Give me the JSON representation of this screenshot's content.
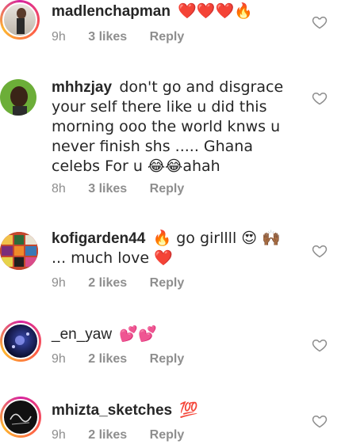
{
  "comments": [
    {
      "username": "madlenchapman",
      "body": "",
      "emojis": "❤️❤️❤️🔥",
      "time": "9h",
      "likes": "3 likes",
      "reply": "Reply"
    },
    {
      "username": "mhhzjay",
      "body": "don't go and disgrace your self there like u did this morning ooo  the world knws u never finish shs ..... Ghana celebs For u 😂😂ahah",
      "time": "8h",
      "likes": "3 likes",
      "reply": "Reply"
    },
    {
      "username": "kofigarden44",
      "body": "🔥 go girllll 😍 🙌🏾 ... much love ❤️",
      "time": "9h",
      "likes": "2 likes",
      "reply": "Reply"
    },
    {
      "username": "_en_yaw",
      "body": "💕💕",
      "time": "9h",
      "likes": "2 likes",
      "reply": "Reply"
    },
    {
      "username": "mhizta_sketches",
      "body": "💯",
      "time": "9h",
      "likes": "2 likes",
      "reply": "Reply"
    }
  ],
  "colors": {
    "like_icon": "#8e8e8e",
    "meta": "#8e8e8e"
  }
}
